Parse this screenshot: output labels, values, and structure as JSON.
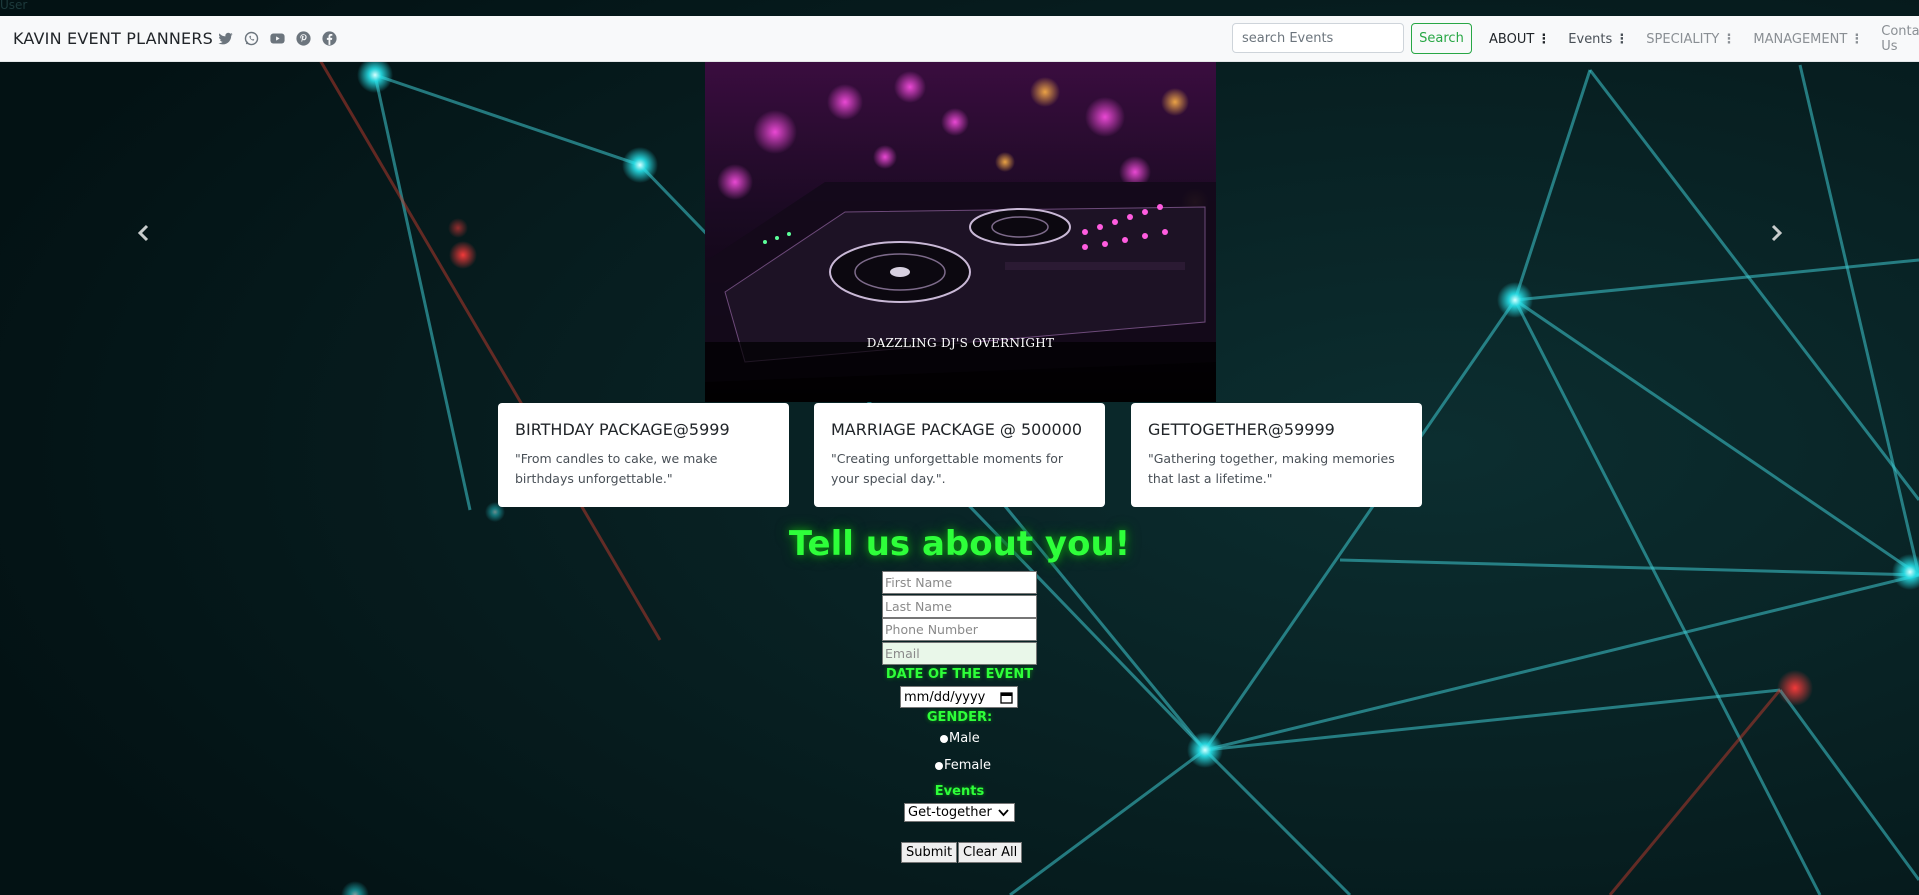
{
  "topbar": {
    "user_label": "User"
  },
  "navbar": {
    "brand": "KAVIN EVENT PLANNERS",
    "social_icons": [
      "twitter-icon",
      "whatsapp-icon",
      "youtube-icon",
      "pinterest-icon",
      "facebook-icon"
    ],
    "search": {
      "placeholder": "search Events",
      "value": "",
      "button_label": "Search"
    },
    "menu": [
      {
        "label": "ABOUT",
        "key": "about"
      },
      {
        "label": "Events",
        "key": "events"
      },
      {
        "label": "SPECIALITY",
        "key": "speciality"
      },
      {
        "label": "MANAGEMENT",
        "key": "management"
      },
      {
        "label": "Contact Us",
        "key": "contact"
      }
    ]
  },
  "carousel": {
    "caption": "DAZZLING DJ'S OVERNIGHT",
    "prev_icon": "chevron-left-icon",
    "next_icon": "chevron-right-icon"
  },
  "packages": [
    {
      "title": "BIRTHDAY PACKAGE@5999",
      "text": "\"From candles to cake, we make birthdays unforgettable.\""
    },
    {
      "title": "MARRIAGE PACKAGE @ 500000",
      "text": "\"Creating unforgettable moments for your special day.\"."
    },
    {
      "title": "GETTOGETHER@59999",
      "text": "\"Gathering together, making memories that last a lifetime.\""
    }
  ],
  "form": {
    "title": "Tell us about you!",
    "first_name_placeholder": "First Name",
    "last_name_placeholder": "Last Name",
    "phone_placeholder": "Phone Number",
    "email_placeholder": "Email",
    "date_label": "DATE OF THE EVENT",
    "date_value": "mm/dd/yyyy",
    "gender_label": "GENDER:",
    "gender_options": [
      "Male",
      "Female"
    ],
    "events_label": "Events",
    "events_selected": "Get-together",
    "submit_label": "Submit",
    "clear_label": "Clear All"
  },
  "colors": {
    "accent_green": "#2eff3a",
    "search_button": "#28a745",
    "background": "#04191b",
    "network_lines": "#3ec9cf"
  }
}
